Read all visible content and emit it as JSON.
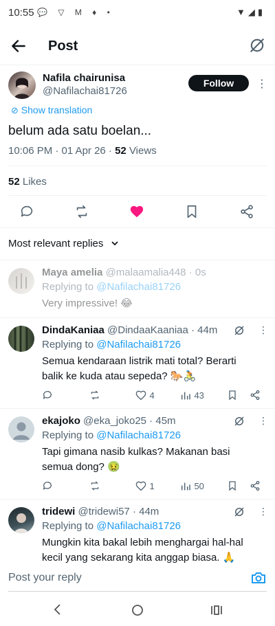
{
  "status": {
    "time": "10:55"
  },
  "header": {
    "title": "Post"
  },
  "post": {
    "author_name": "Nafila chairunisa",
    "author_handle": "@Nafilachai81726",
    "follow_label": "Follow",
    "show_translation": "Show translation",
    "text": "belum ada satu boelan...",
    "timestamp": "10:06 PM · 01 Apr 26 · ",
    "views_count": "52",
    "views_label": " Views",
    "likes_count": "52",
    "likes_label": " Likes"
  },
  "replies_sort": {
    "label": "Most relevant replies"
  },
  "replies": [
    {
      "name": "Maya amelia",
      "handle": "@malaamalia448",
      "time": " · 0s",
      "replying_prefix": "Replying to ",
      "replying_to": "@Nafilachai81726",
      "text": "Very impressive! 😂"
    },
    {
      "name": "DindaKaniaa",
      "handle": "@DindaaKaaniaa",
      "time": " · 44m",
      "replying_prefix": "Replying to ",
      "replying_to": "@Nafilachai81726",
      "text_line1": "Semua kendaraan listrik mati total? Berarti",
      "text_line2": "balik ke kuda atau sepeda? 🐎🚴",
      "likes": "4",
      "views": "43"
    },
    {
      "name": "ekajoko",
      "handle": "@eka_joko25",
      "time": " · 45m",
      "replying_prefix": "Replying to ",
      "replying_to": "@Nafilachai81726",
      "text_line1": "Tapi gimana nasib kulkas? Makanan basi",
      "text_line2": "semua dong? 🤢",
      "likes": "1",
      "views": "50"
    },
    {
      "name": "tridewi",
      "handle": "@tridewi57",
      "time": " · 44m",
      "replying_prefix": "Replying to ",
      "replying_to": "@Nafilachai81726",
      "text_line1": "Mungkin kita bakal lebih menghargai hal-hal",
      "text_line2": "kecil yang sekarang kita anggap biasa. 🙏"
    }
  ],
  "reply_input": {
    "placeholder": "Post your reply"
  },
  "colors": {
    "accent": "#1d9bf0",
    "like": "#f91880",
    "text": "#0f1419",
    "muted": "#536471"
  }
}
